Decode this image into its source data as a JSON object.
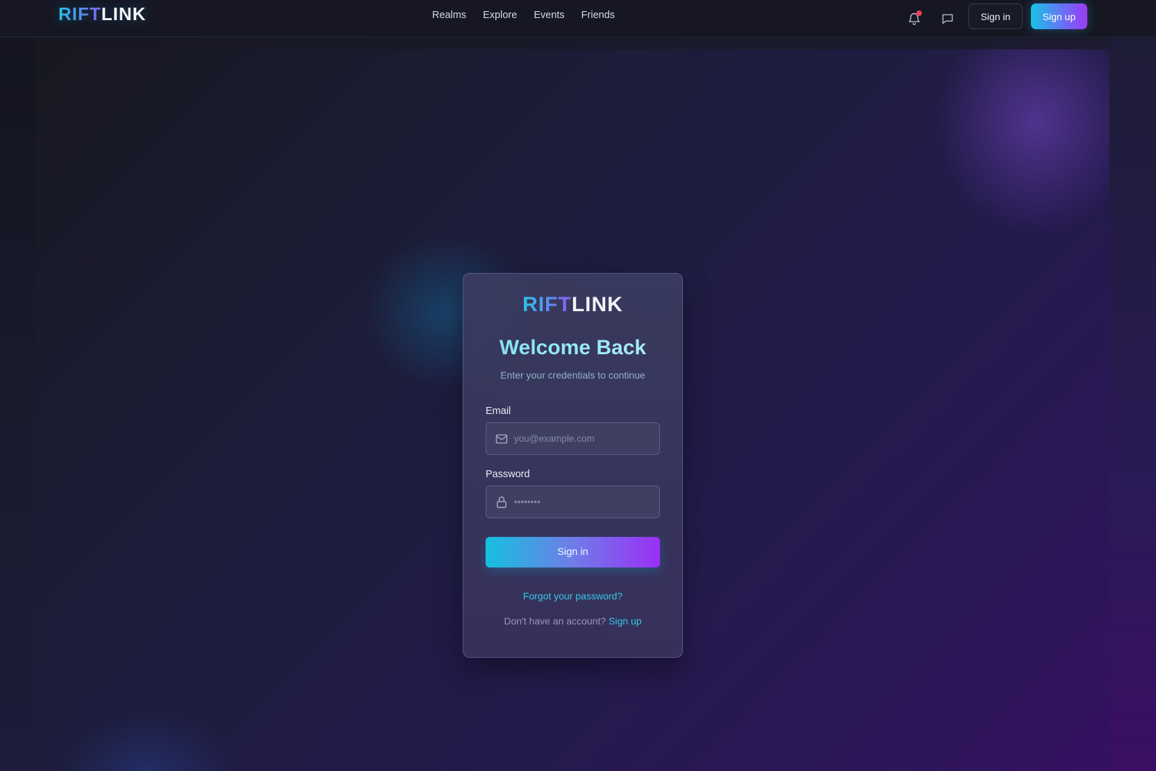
{
  "brand": {
    "part_a": "RIFT",
    "part_b": "LINK"
  },
  "nav": {
    "items": [
      "Realms",
      "Explore",
      "Events",
      "Friends"
    ]
  },
  "header": {
    "sign_in_label": "Sign in",
    "sign_up_label": "Sign up",
    "icons": [
      "bell-icon",
      "chat-icon"
    ],
    "notification_dot_color": "#ef3b4c"
  },
  "login": {
    "title": "Welcome Back",
    "subtitle": "Enter your credentials to continue",
    "email_label": "Email",
    "email_placeholder": "you@example.com",
    "password_label": "Password",
    "password_placeholder": "••••••••",
    "submit_label": "Sign in",
    "forgot_label": "Forgot your password?",
    "no_account_text": "Don't have an account?",
    "sign_up_link": "Sign up"
  },
  "colors": {
    "accent_cyan": "#18c3e6",
    "accent_purple": "#9a3cf2",
    "link": "#37c9e6"
  }
}
